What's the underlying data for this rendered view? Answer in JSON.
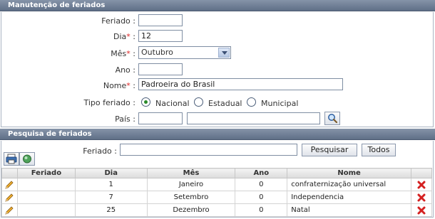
{
  "manutencao": {
    "title": "Manutenção de feriados",
    "feriado_label": "Feriado :",
    "feriado_value": "",
    "dia_label": "Dia",
    "dia_value": "12",
    "mes_label": "Mês",
    "mes_value": "Outubro",
    "ano_label": "Ano :",
    "ano_value": "",
    "nome_label": "Nome",
    "nome_value": "Padroeira do Brasil",
    "tipo_label": "Tipo feriado :",
    "tipo_options": [
      "Nacional",
      "Estadual",
      "Municipal"
    ],
    "tipo_selected": "Nacional",
    "pais_label": "País :",
    "pais_code": "",
    "pais_name": "",
    "required_mark": "*",
    "required_suffix": " :"
  },
  "pesquisa": {
    "title": "Pesquisa de feriados",
    "feriado_label": "Feriado :",
    "feriado_value": "",
    "pesquisar_label": "Pesquisar",
    "todos_label": "Todos"
  },
  "grid": {
    "columns": [
      "Feriado",
      "Dia",
      "Mês",
      "Ano",
      "Nome"
    ],
    "rows": [
      {
        "feriado": "",
        "dia": "1",
        "mes": "Janeiro",
        "ano": "0",
        "nome": "confraternização universal"
      },
      {
        "feriado": "",
        "dia": "7",
        "mes": "Setembro",
        "ano": "0",
        "nome": "Independencia"
      },
      {
        "feriado": "",
        "dia": "25",
        "mes": "Dezembro",
        "ano": "0",
        "nome": "Natal"
      }
    ]
  },
  "icons": {
    "edit": "pencil-icon",
    "delete": "delete-x-icon",
    "search": "magnifier-icon",
    "print": "printer-icon",
    "globe": "globe-icon"
  },
  "colors": {
    "header": "#6b7a92",
    "required": "#dd2222",
    "radio_checked": "#2a8a2a",
    "delete": "#d42020"
  }
}
